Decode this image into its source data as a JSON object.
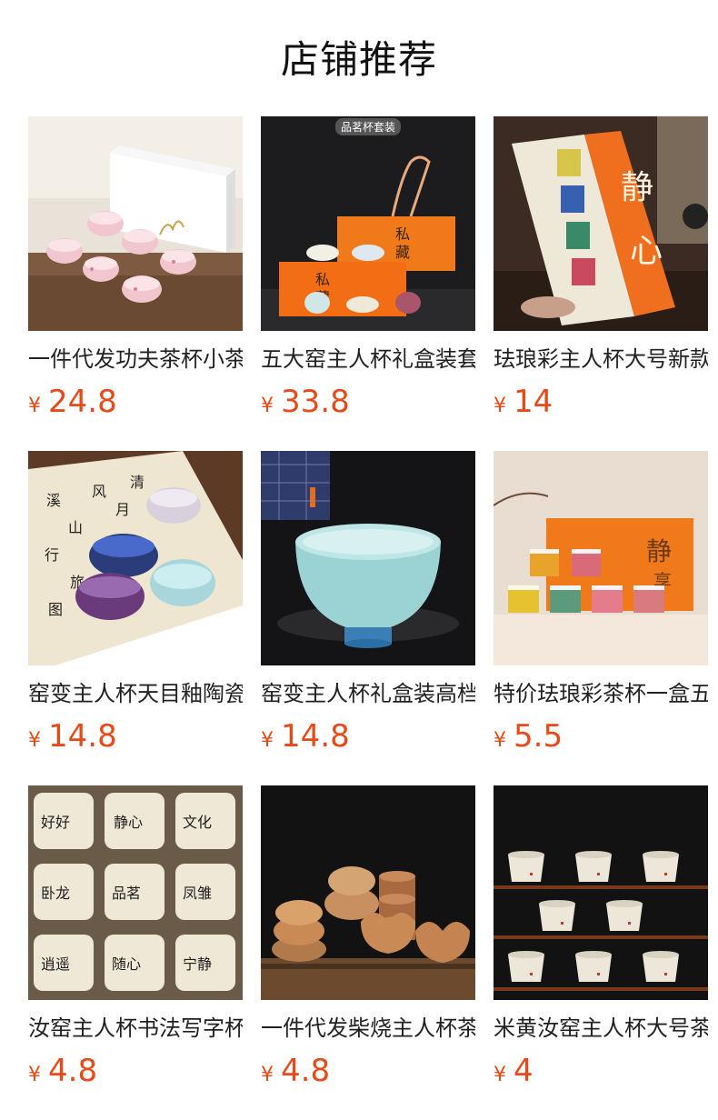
{
  "header": {
    "title": "店铺推荐"
  },
  "currency_symbol": "¥",
  "accent_color": "#e64a19",
  "products": [
    {
      "name": "一件代发功夫茶杯小茶杯",
      "price": "24.8"
    },
    {
      "name": "五大窑主人杯礼盒装套装",
      "price": "33.8",
      "badge": "品茗杯套装"
    },
    {
      "name": "珐琅彩主人杯大号新款",
      "price": "14"
    },
    {
      "name": "窑变主人杯天目釉陶瓷",
      "price": "14.8"
    },
    {
      "name": "窑变主人杯礼盒装高档",
      "price": "14.8"
    },
    {
      "name": "特价珐琅彩茶杯一盒五只",
      "price": "5.5"
    },
    {
      "name": "汝窑主人杯书法写字杯",
      "price": "4.8"
    },
    {
      "name": "一件代发柴烧主人杯茶杯",
      "price": "4.8"
    },
    {
      "name": "米黄汝窑主人杯大号茶杯",
      "price": "4"
    }
  ]
}
